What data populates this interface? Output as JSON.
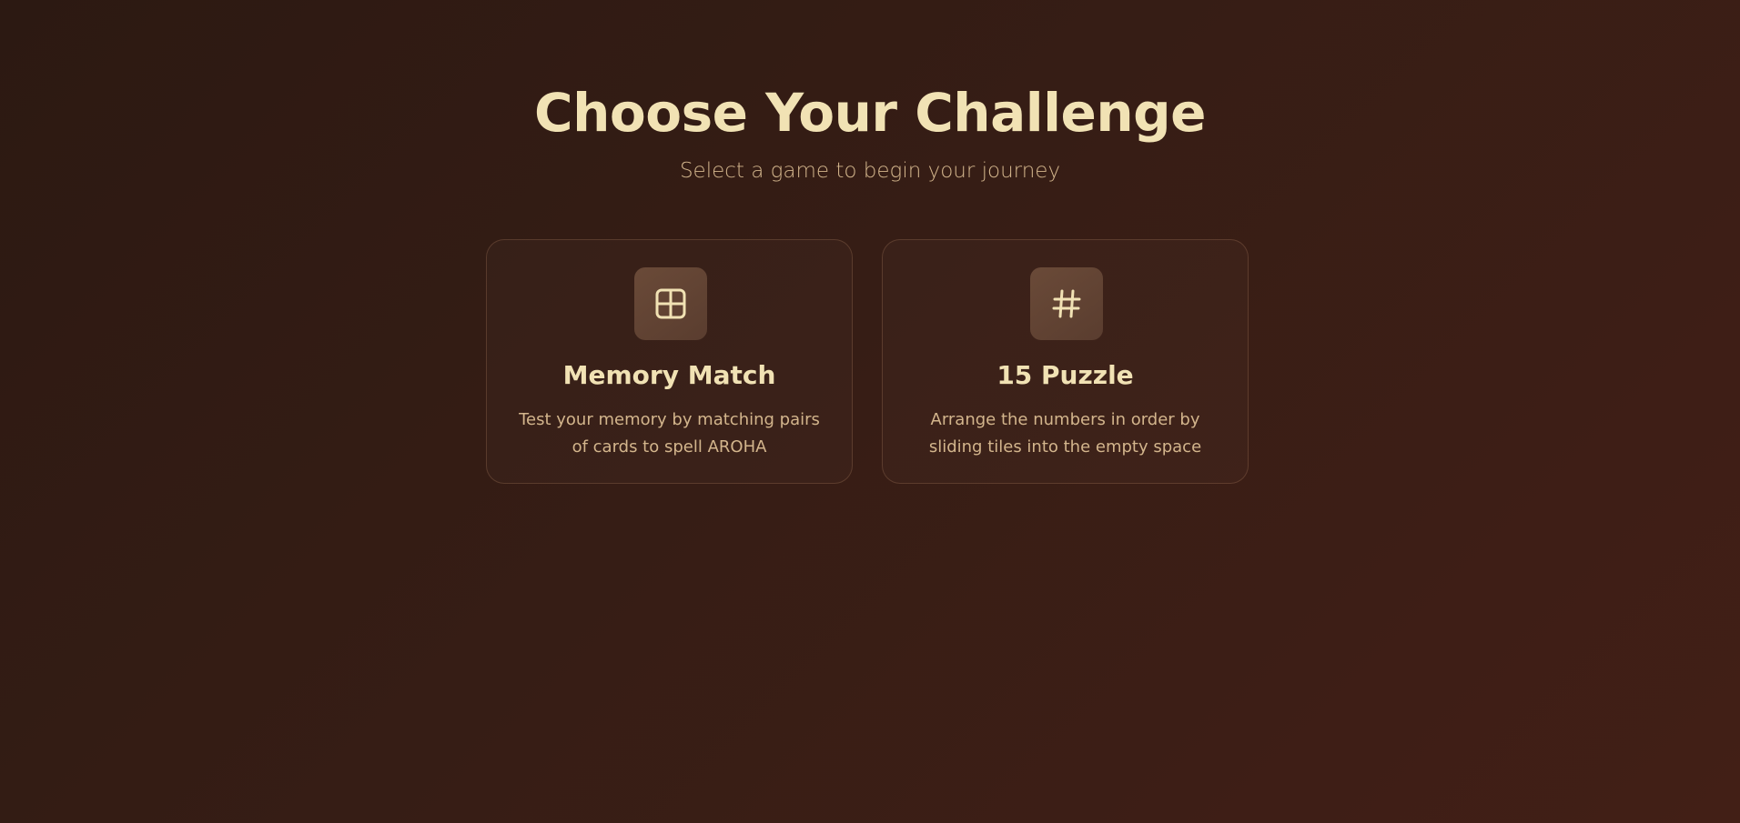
{
  "header": {
    "title": "Choose Your Challenge",
    "subtitle": "Select a game to begin your journey"
  },
  "games": [
    {
      "icon": "grid-icon",
      "title": "Memory Match",
      "description": "Test your memory by matching pairs of cards to spell AROHA"
    },
    {
      "icon": "hash-icon",
      "title": "15 Puzzle",
      "description": "Arrange the numbers in order by sliding tiles into the empty space"
    }
  ],
  "colors": {
    "background": "#361d15",
    "accent_text": "#f1e2b4",
    "muted_text": "#d3b58c",
    "icon_tile": "#5f4133"
  }
}
